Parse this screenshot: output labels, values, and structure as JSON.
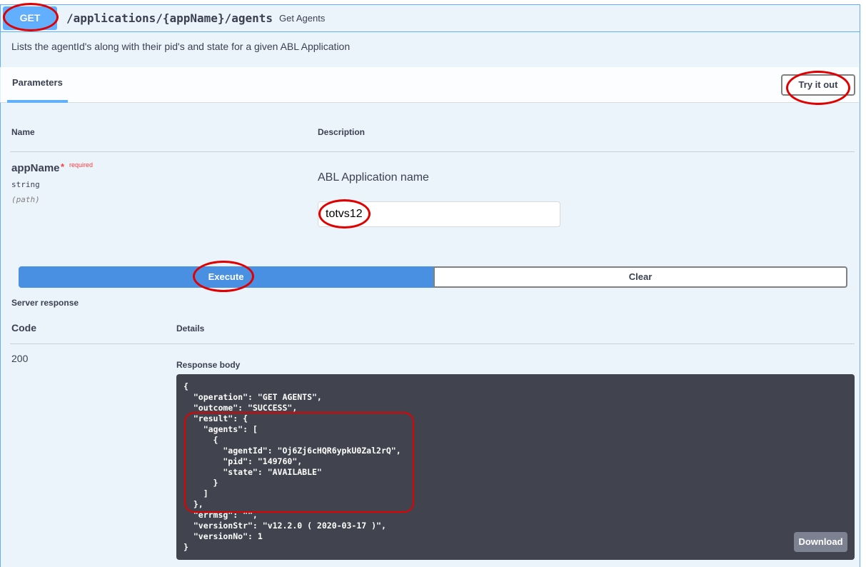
{
  "operation": {
    "method": "GET",
    "path": "/applications/{appName}/agents",
    "summary": "Get Agents",
    "description": "Lists the agentId's along with their pid's and state for a given ABL Application"
  },
  "parameters": {
    "tab_label": "Parameters",
    "try_button": "Try it out",
    "col_name": "Name",
    "col_description": "Description",
    "param": {
      "name": "appName",
      "star": "*",
      "required": "required",
      "type": "string",
      "in": "(path)",
      "description": "ABL Application name",
      "value": "totvs12"
    }
  },
  "actions": {
    "execute": "Execute",
    "clear": "Clear"
  },
  "response": {
    "section_label": "Server response",
    "code_header": "Code",
    "details_header": "Details",
    "code": "200",
    "body_label": "Response body",
    "body": "{\n  \"operation\": \"GET AGENTS\",\n  \"outcome\": \"SUCCESS\",\n  \"result\": {\n    \"agents\": [\n      {\n        \"agentId\": \"Oj6Zj6cHQR6ypkU0Zal2rQ\",\n        \"pid\": \"149760\",\n        \"state\": \"AVAILABLE\"\n      }\n    ]\n  },\n  \"errmsg\": \"\",\n  \"versionStr\": \"v12.2.0 ( 2020-03-17 )\",\n  \"versionNo\": 1\n}",
    "download": "Download"
  },
  "colors": {
    "accent": "#61affe",
    "execute": "#4990e2",
    "annotation": "#e00000",
    "code_bg": "#41444e"
  }
}
